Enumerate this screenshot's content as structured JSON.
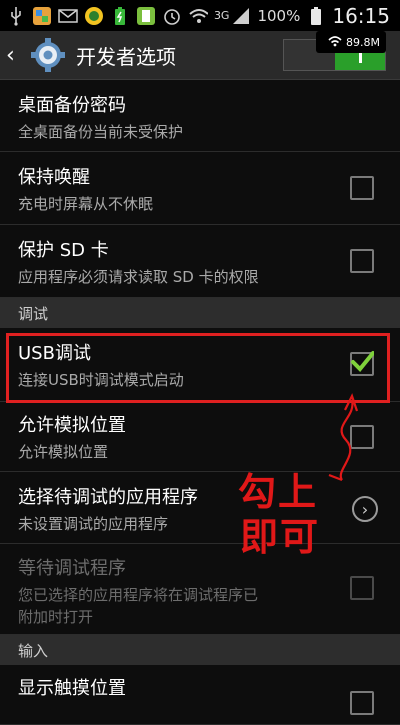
{
  "status_bar": {
    "signal_text": "3G",
    "battery_percent": "100%",
    "time": "16:15"
  },
  "action_bar": {
    "title": "开发者选项",
    "master_switch_on": true,
    "wifi_speed": "89.8M"
  },
  "rows": [
    {
      "title": "桌面备份密码",
      "summary": "全桌面备份当前未受保护"
    },
    {
      "title": "保持唤醒",
      "summary": "充电时屏幕从不休眠",
      "checked": false
    },
    {
      "title": "保护 SD 卡",
      "summary": "应用程序必须请求读取 SD 卡的权限",
      "checked": false
    }
  ],
  "section_debug": "调试",
  "debug_rows": [
    {
      "title": "USB调试",
      "summary": "连接USB时调试模式启动",
      "checked": true
    },
    {
      "title": "允许模拟位置",
      "summary": "允许模拟位置",
      "checked": false
    },
    {
      "title": "选择待调试的应用程序",
      "summary": "未设置调试的应用程序"
    },
    {
      "title": "等待调试程序",
      "summary_line1": "您已选择的应用程序将在调试程序已",
      "summary_line2": "附加时打开",
      "checked": false,
      "disabled": true
    }
  ],
  "section_input": "输入",
  "input_rows": [
    {
      "title": "显示触摸位置"
    }
  ],
  "annotation": {
    "line1": "勾上",
    "line2": "即可",
    "color": "#e01818"
  },
  "colors": {
    "check_green": "#7fd13b",
    "switch_green": "#2a9f2a",
    "highlight_red": "#e02020"
  }
}
